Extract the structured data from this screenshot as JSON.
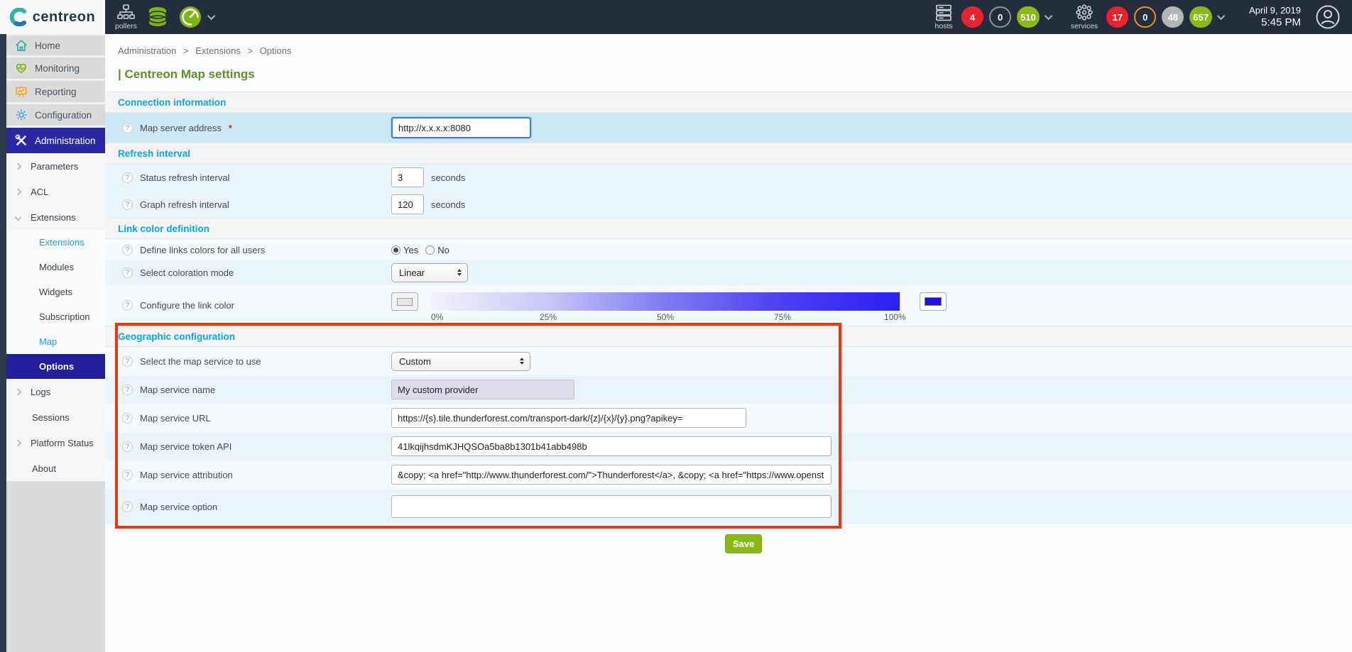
{
  "header": {
    "logo_text": "centreon",
    "pollers_label": "pollers",
    "hosts_label": "hosts",
    "services_label": "services",
    "host_badges": {
      "down": "4",
      "unreachable": "0",
      "up": "510"
    },
    "service_badges": {
      "critical": "17",
      "warning": "0",
      "unknown": "48",
      "ok": "657"
    },
    "date": "April 9, 2019",
    "time": "5:45 PM"
  },
  "sidebar": {
    "level1": [
      {
        "label": "Home"
      },
      {
        "label": "Monitoring"
      },
      {
        "label": "Reporting"
      },
      {
        "label": "Configuration"
      },
      {
        "label": "Administration"
      }
    ],
    "sub": [
      {
        "label": "Parameters"
      },
      {
        "label": "ACL"
      },
      {
        "label": "Extensions",
        "children": [
          {
            "label": "Extensions"
          },
          {
            "label": "Modules"
          },
          {
            "label": "Widgets"
          },
          {
            "label": "Subscription"
          },
          {
            "label": "Map"
          },
          {
            "label": "Options"
          }
        ]
      },
      {
        "label": "Logs"
      },
      {
        "label": "Sessions"
      },
      {
        "label": "Platform Status"
      },
      {
        "label": "About"
      }
    ]
  },
  "breadcrumb": {
    "items": [
      "Administration",
      "Extensions",
      "Options"
    ],
    "separator": ">"
  },
  "page": {
    "title_marker": "|",
    "title": "Centreon Map settings"
  },
  "icons": {
    "help": "?"
  },
  "form": {
    "required_marker": "*",
    "sections": {
      "connection": "Connection information",
      "refresh": "Refresh interval",
      "linkcolor": "Link color definition",
      "geographic": "Geographic configuration"
    },
    "fields": {
      "map_server_address": {
        "label": "Map server address",
        "value": "http://x.x.x.x:8080"
      },
      "status_refresh": {
        "label": "Status refresh interval",
        "value": "3",
        "suffix": "seconds"
      },
      "graph_refresh": {
        "label": "Graph refresh interval",
        "value": "120",
        "suffix": "seconds"
      },
      "define_links_colors": {
        "label": "Define links colors for all users",
        "options": [
          "Yes",
          "No"
        ],
        "selected": "Yes"
      },
      "coloration_mode": {
        "label": "Select coloration mode",
        "value": "Linear"
      },
      "link_color": {
        "label": "Configure the link color",
        "gradient_labels": [
          "0%",
          "25%",
          "50%",
          "75%",
          "100%"
        ],
        "selected_color": "#1a10f0"
      },
      "map_service": {
        "label": "Select the map service to use",
        "value": "Custom"
      },
      "map_service_name": {
        "label": "Map service name",
        "value": "My custom provider"
      },
      "map_service_url": {
        "label": "Map service URL",
        "value": "https://{s}.tile.thunderforest.com/transport-dark/{z}/{x}/{y}.png?apikey="
      },
      "map_service_token": {
        "label": "Map service token API",
        "value": "41lkqijhsdmKJHQSOa5ba8b1301b41abb498b"
      },
      "map_service_attribution": {
        "label": "Map service attribution",
        "value": "&copy; <a href=\"http://www.thunderforest.com/\">Thunderforest</a>, &copy; <a href=\"https://www.openst"
      },
      "map_service_option": {
        "label": "Map service option",
        "value": ""
      }
    },
    "save_label": "Save"
  },
  "colors": {
    "header_bg": "#232d3d",
    "accent_cyan": "#0da6e1",
    "title_green": "#5f9026",
    "active_indigo": "#2b27a3",
    "selected_indigo": "#221e9e",
    "badge_red": "#e8222e",
    "badge_green": "#88b917",
    "badge_gray": "#b5b5b5",
    "badge_orange_border": "#f19116",
    "row_highlight": "#cde9f7",
    "row_blue": "#e9f5fb",
    "red_annotation_box": "#e8380d",
    "gradient_end": "#2a21f1",
    "save_green": "#88b917"
  }
}
